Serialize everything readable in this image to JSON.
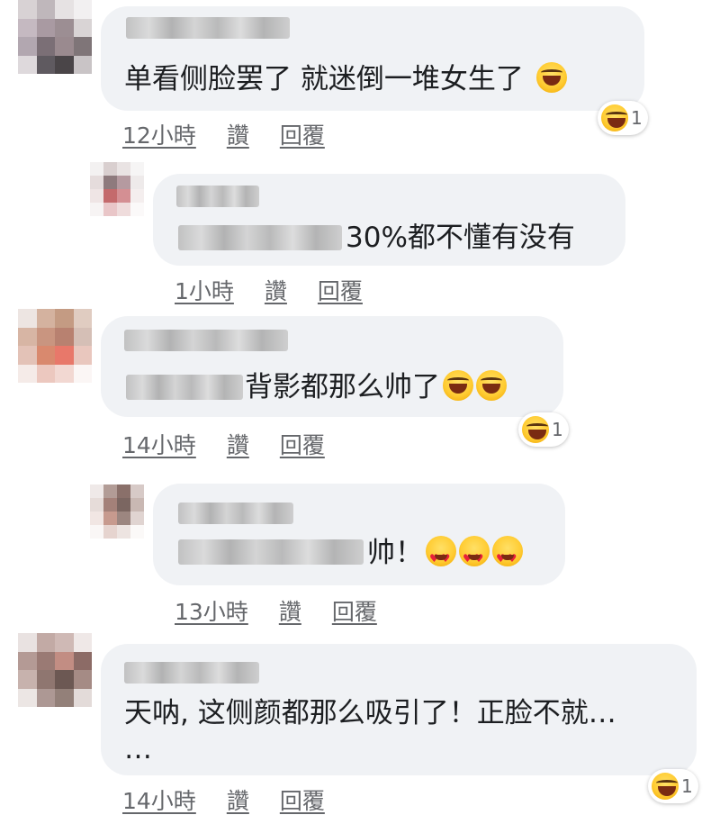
{
  "comments": [
    {
      "text": "单看侧脸罢了 就迷倒一堆女生了",
      "emoji": "laughing-emoji",
      "time": "12小時",
      "like": "讚",
      "reply": "回覆",
      "reaction_count": "1"
    },
    {
      "text": "30%都不懂有没有",
      "time": "1小時",
      "like": "讚",
      "reply": "回覆"
    },
    {
      "text": "背影都那么帅了",
      "emoji": "laughing-emoji",
      "time": "14小時",
      "like": "讚",
      "reply": "回覆",
      "reaction_count": "1"
    },
    {
      "text": "帅！",
      "emoji": "heart-eyes-emoji",
      "time": "13小時",
      "like": "讚",
      "reply": "回覆"
    },
    {
      "text": "天呐, 这侧颜都那么吸引了！正脸不就…",
      "text2": "…",
      "time": "14小時",
      "like": "讚",
      "reply": "回覆",
      "reaction_count": "1"
    }
  ]
}
